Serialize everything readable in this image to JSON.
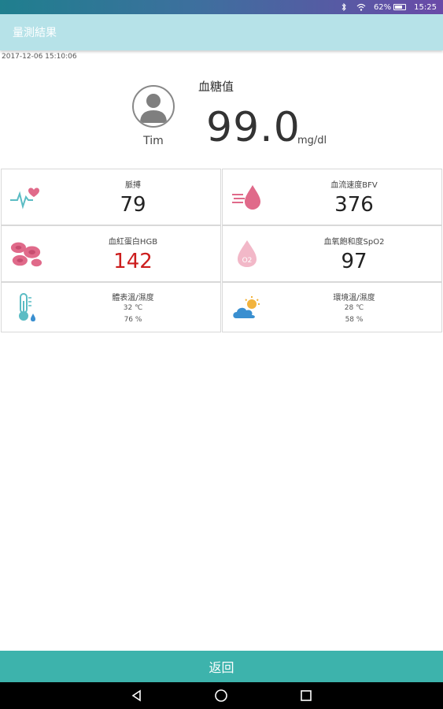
{
  "status_bar": {
    "battery_percent": "62%",
    "time": "15:25",
    "icons": [
      "bluetooth-icon",
      "wifi-icon",
      "battery-icon"
    ]
  },
  "app_bar": {
    "title": "量測結果"
  },
  "measurement": {
    "timestamp": "2017-12-06 15:10:06",
    "user_name": "Tim",
    "blood_glucose_label": "血糖值",
    "blood_glucose_value": "99.0",
    "blood_glucose_unit": "mg/dl"
  },
  "cards": {
    "pulse": {
      "label": "脈搏",
      "value": "79",
      "icon": "heart-pulse-icon"
    },
    "bfv": {
      "label": "血流速度BFV",
      "value": "376",
      "icon": "blood-drop-flow-icon"
    },
    "hgb": {
      "label": "血紅蛋白HGB",
      "value": "142",
      "icon": "red-blood-cells-icon"
    },
    "spo2": {
      "label": "血氧飽和度SpO2",
      "value": "97",
      "icon": "oxygen-drop-icon"
    },
    "body": {
      "label": "體表溫/濕度",
      "temperature": "32 ℃",
      "humidity": "76 %",
      "icon": "thermometer-icon"
    },
    "env": {
      "label": "環境溫/濕度",
      "temperature": "28 ℃",
      "humidity": "58 %",
      "icon": "weather-icon"
    }
  },
  "back_button": {
    "label": "返回"
  },
  "colors": {
    "app_bar": "#b6e2e8",
    "back_bar": "#3db3ac",
    "hgb_value": "#cc1d1d",
    "icon_pink": "#e06a8a",
    "icon_teal": "#5bbcc4",
    "icon_blue": "#3a8fd0"
  },
  "nav_bar": {
    "icons": [
      "back-triangle-icon",
      "home-circle-icon",
      "recents-square-icon"
    ]
  }
}
